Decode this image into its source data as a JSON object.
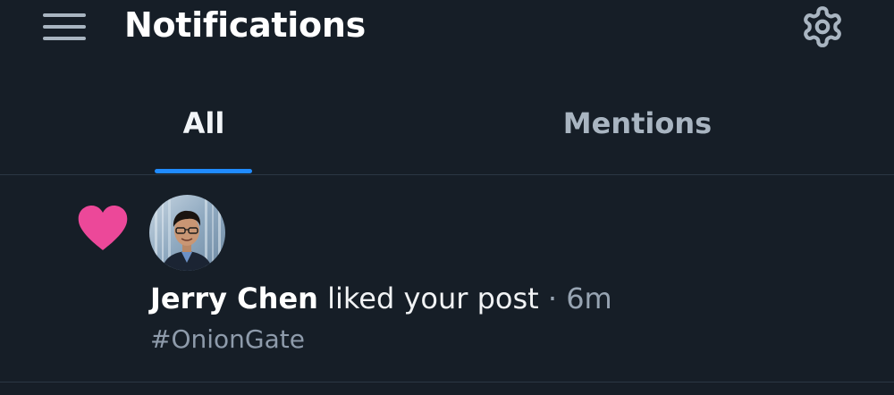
{
  "header": {
    "title": "Notifications",
    "menu_icon": "hamburger-menu-icon",
    "settings_icon": "gear-icon"
  },
  "tabs": [
    {
      "label": "All",
      "active": true
    },
    {
      "label": "Mentions",
      "active": false
    }
  ],
  "notifications": [
    {
      "type_icon": "heart-icon",
      "author": "Jerry Chen",
      "action": "liked your post",
      "separator": "·",
      "time": "6m",
      "snippet": "#OnionGate"
    }
  ],
  "colors": {
    "background": "#161e27",
    "accent": "#208bfe",
    "heart": "#ec4899",
    "divider": "#2b3744",
    "muted_text": "#97a4b2"
  }
}
